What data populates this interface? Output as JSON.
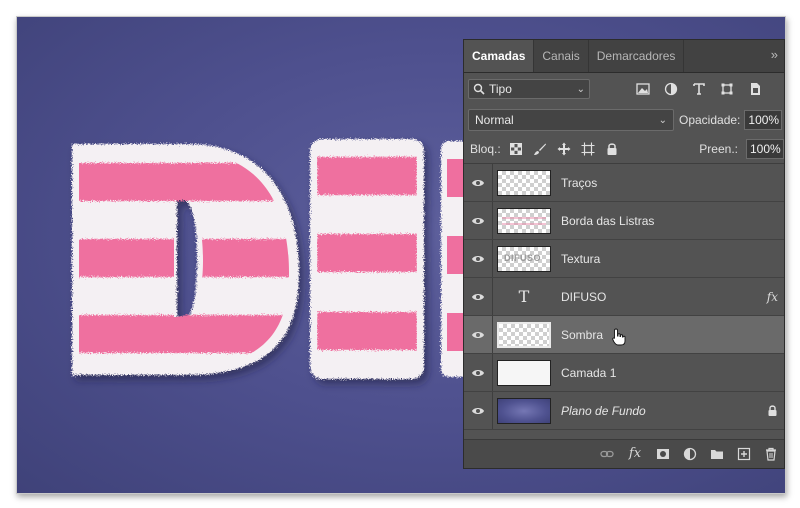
{
  "panel": {
    "tabs": [
      {
        "label": "Camadas",
        "active": true
      },
      {
        "label": "Canais",
        "active": false
      },
      {
        "label": "Demarcadores",
        "active": false
      }
    ],
    "collapse_icon": "double-chevron-right-icon",
    "filter": {
      "value": "Tipo",
      "icon": "search-icon"
    },
    "filter_icons": [
      "image-filter-icon",
      "adjustment-filter-icon",
      "type-filter-icon",
      "shape-filter-icon",
      "smart-object-filter-icon"
    ],
    "blend_mode": "Normal",
    "opacity_label": "Opacidade:",
    "opacity_value": "100%",
    "lock_label": "Bloq.:",
    "lock_icons": [
      "lock-transparency-icon",
      "lock-brush-icon",
      "lock-move-icon",
      "lock-artboard-icon",
      "lock-all-icon"
    ],
    "fill_label": "Preen.:",
    "fill_value": "100%"
  },
  "layers": [
    {
      "name": "Traços",
      "thumb": "transparent",
      "visible": true
    },
    {
      "name": "Borda das Listras",
      "thumb": "stripes",
      "visible": true
    },
    {
      "name": "Textura",
      "thumb": "texture",
      "visible": true
    },
    {
      "name": "DIFUSO",
      "thumb": "type",
      "visible": true,
      "fx": "fx"
    },
    {
      "name": "Sombra",
      "thumb": "shadow",
      "visible": true,
      "selected": true
    },
    {
      "name": "Camada 1",
      "thumb": "white",
      "visible": true
    },
    {
      "name": "Plano de Fundo",
      "thumb": "background",
      "visible": true,
      "locked": true
    }
  ],
  "type_thumb_glyph": "T",
  "texture_thumb_text": "DIFUSO",
  "bottom_icons": [
    "link-layers-icon",
    "fx-icon",
    "layer-mask-icon",
    "adjustment-layer-icon",
    "folder-icon",
    "new-layer-icon",
    "trash-icon"
  ],
  "bottom_fx_label": "fx",
  "colors": {
    "stripe_pink": "#ef6f9f",
    "fur_white": "#f7f4f6",
    "canvas_blue": "#4f5290",
    "panel_bg": "#535353"
  }
}
